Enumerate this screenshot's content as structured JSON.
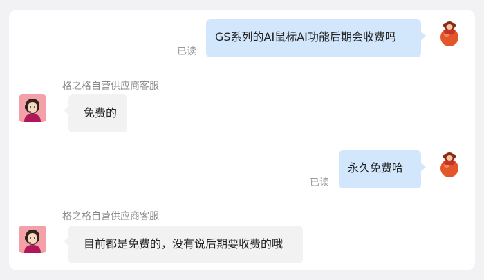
{
  "messages": [
    {
      "direction": "outgoing",
      "text": "GS系列的AI鼠标AI功能后期会收费吗",
      "status": "已读"
    },
    {
      "direction": "incoming",
      "sender": "格之格自营供应商客服",
      "text": "免费的"
    },
    {
      "direction": "outgoing",
      "text": "永久免费哈",
      "status": "已读"
    },
    {
      "direction": "incoming",
      "sender": "格之格自营供应商客服",
      "text": "目前都是免费的，没有说后期要收费的哦"
    }
  ],
  "colors": {
    "outgoing_bubble": "#d2e6fc",
    "incoming_bubble": "#f2f2f2",
    "read_status": "#9a9a9a",
    "sender_name": "#8a8a8a",
    "background": "#f2f2f4"
  },
  "icons": {
    "user_avatar": "monkey-on-ball-avatar-icon",
    "agent_avatar": "customer-service-agent-avatar-icon"
  }
}
